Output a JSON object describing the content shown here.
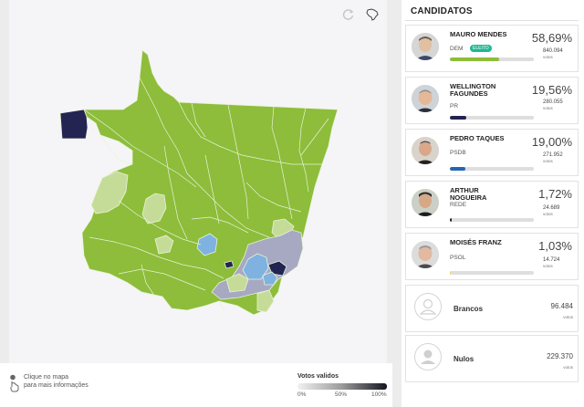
{
  "map": {
    "colors": {
      "mendes": "#8dbd3a",
      "mendes_light": "#c5dc98",
      "taques": "#7fb2e0",
      "fagundes_dark": "#232452",
      "fagundes_mid": "#a7a8c2",
      "border": "#e8f2d8"
    },
    "reset_icon": "reset-icon",
    "brazil_icon": "brazil-map-icon"
  },
  "footer": {
    "hint_line1": "Clique no mapa",
    "hint_line2": "para mais informações",
    "votes_title": "Votos validos",
    "scale_min": "0%",
    "scale_mid": "50%",
    "scale_max": "100%"
  },
  "panel": {
    "title": "CANDIDATOS",
    "candidates": [
      {
        "name": "MAURO MENDES",
        "party": "DEM",
        "badge": "ELEITO",
        "pct": "58,69%",
        "votes": "840.094",
        "votes_label": "votos",
        "share": 0.5869,
        "color": "#8dbd3a"
      },
      {
        "name": "WELLINGTON FAGUNDES",
        "party": "PR",
        "pct": "19,56%",
        "votes": "280.055",
        "votes_label": "votos",
        "share": 0.1956,
        "color": "#22234f"
      },
      {
        "name": "PEDRO TAQUES",
        "party": "PSDB",
        "pct": "19,00%",
        "votes": "271.952",
        "votes_label": "votos",
        "share": 0.19,
        "color": "#2566b0"
      },
      {
        "name": "ARTHUR NOGUEIRA",
        "party": "REDE",
        "pct": "1,72%",
        "votes": "24.689",
        "votes_label": "votos",
        "share": 0.0172,
        "color": "#222222"
      },
      {
        "name": "MOISÉS FRANZ",
        "party": "PSOL",
        "pct": "1,03%",
        "votes": "14.724",
        "votes_label": "votos",
        "share": 0.0103,
        "color": "#e3d34a"
      }
    ],
    "brancos": {
      "label": "Brancos",
      "value": "96.484",
      "unit": "votos"
    },
    "nulos": {
      "label": "Nulos",
      "value": "229.370",
      "unit": "votos"
    }
  }
}
